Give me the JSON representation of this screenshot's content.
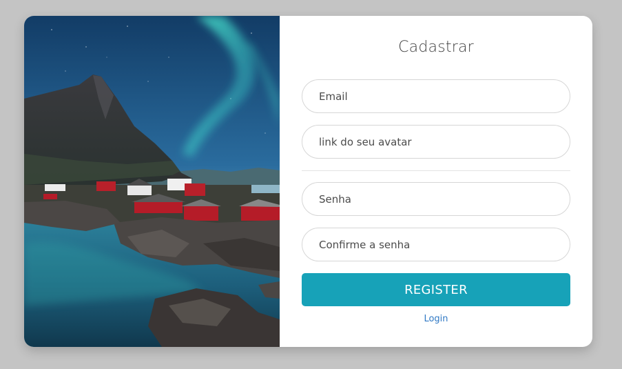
{
  "form": {
    "title": "Cadastrar",
    "email_placeholder": "Email",
    "avatar_placeholder": "link do seu avatar",
    "password_placeholder": "Senha",
    "confirm_placeholder": "Confirme a senha",
    "register_label": "REGISTER",
    "login_label": "Login"
  },
  "colors": {
    "page_background": "#c4c4c4",
    "card_background": "#ffffff",
    "register_button": "#17a2b8",
    "login_link": "#2f78c4"
  }
}
